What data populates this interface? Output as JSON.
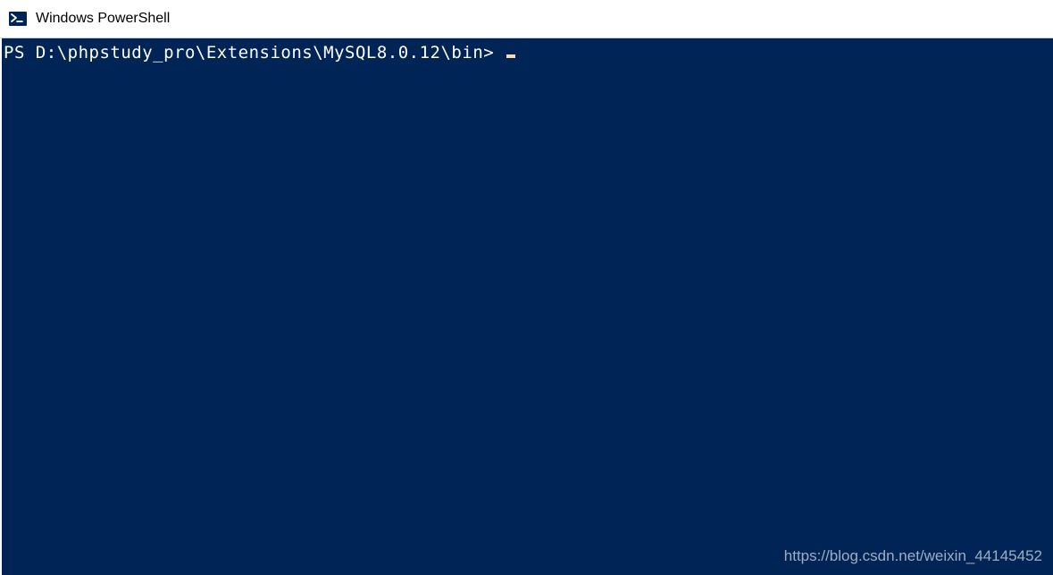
{
  "window": {
    "title": "Windows PowerShell"
  },
  "terminal": {
    "prompt": "PS D:\\phpstudy_pro\\Extensions\\MySQL8.0.12\\bin>",
    "background": "#012456",
    "foreground": "#ffffff"
  },
  "watermark": {
    "text": "https://blog.csdn.net/weixin_44145452"
  }
}
